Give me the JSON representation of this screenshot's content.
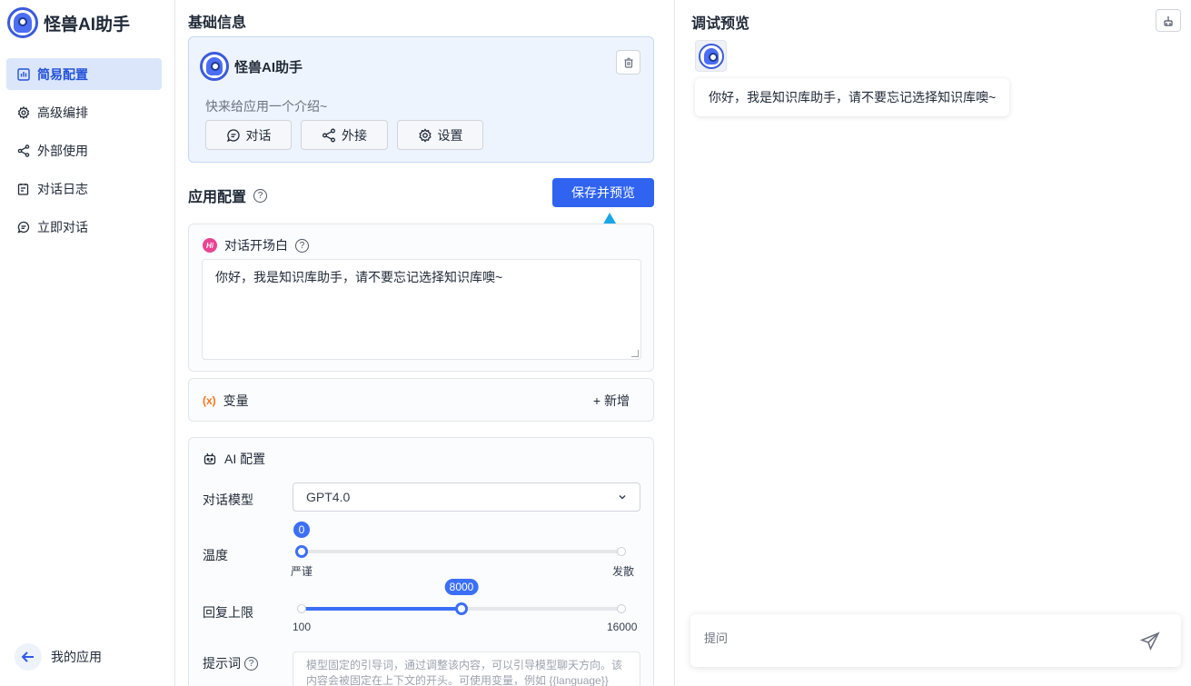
{
  "brand": {
    "title": "怪兽AI助手",
    "logo_icon": "monster-logo-icon"
  },
  "sidebar": {
    "items": [
      {
        "label": "简易配置",
        "icon": "bar-chart-icon",
        "active": true
      },
      {
        "label": "高级编排",
        "icon": "gear-icon",
        "active": false
      },
      {
        "label": "外部使用",
        "icon": "share-icon",
        "active": false
      },
      {
        "label": "对话日志",
        "icon": "log-icon",
        "active": false
      },
      {
        "label": "立即对话",
        "icon": "chat-icon",
        "active": false
      }
    ],
    "my_apps_label": "我的应用"
  },
  "basic": {
    "section_title": "基础信息",
    "app_name": "怪兽AI助手",
    "intro_placeholder": "快来给应用一个介绍~",
    "actions": {
      "chat": "对话",
      "share": "外接",
      "settings": "设置"
    }
  },
  "config": {
    "title": "应用配置",
    "save_label": "保存并预览",
    "opening": {
      "label": "对话开场白",
      "text": "你好，我是知识库助手，请不要忘记选择知识库噢~"
    },
    "variables": {
      "icon_text": "(x)",
      "label": "变量",
      "add_label": "+ 新增"
    },
    "ai": {
      "title": "AI 配置",
      "model_label": "对话模型",
      "model_value": "GPT4.0",
      "temperature": {
        "label": "温度",
        "value": "0",
        "min_label": "严谨",
        "max_label": "发散",
        "fraction": 0
      },
      "max_tokens": {
        "label": "回复上限",
        "value": "8000",
        "min_label": "100",
        "max_label": "16000",
        "fraction": 0.5
      },
      "prompt": {
        "label": "提示词",
        "placeholder": "模型固定的引导词，通过调整该内容，可以引导模型聊天方向。该内容会被固定在上下文的开头。可使用变量，例如 {{language}}"
      }
    }
  },
  "preview": {
    "title": "调试预览",
    "bot_message": "你好，我是知识库助手，请不要忘记选择知识库噢~",
    "input_placeholder": "提问"
  },
  "colors": {
    "accent": "#2f63f0",
    "active_nav_bg": "#dbe6fb",
    "arrow": "#1aa6e6"
  }
}
